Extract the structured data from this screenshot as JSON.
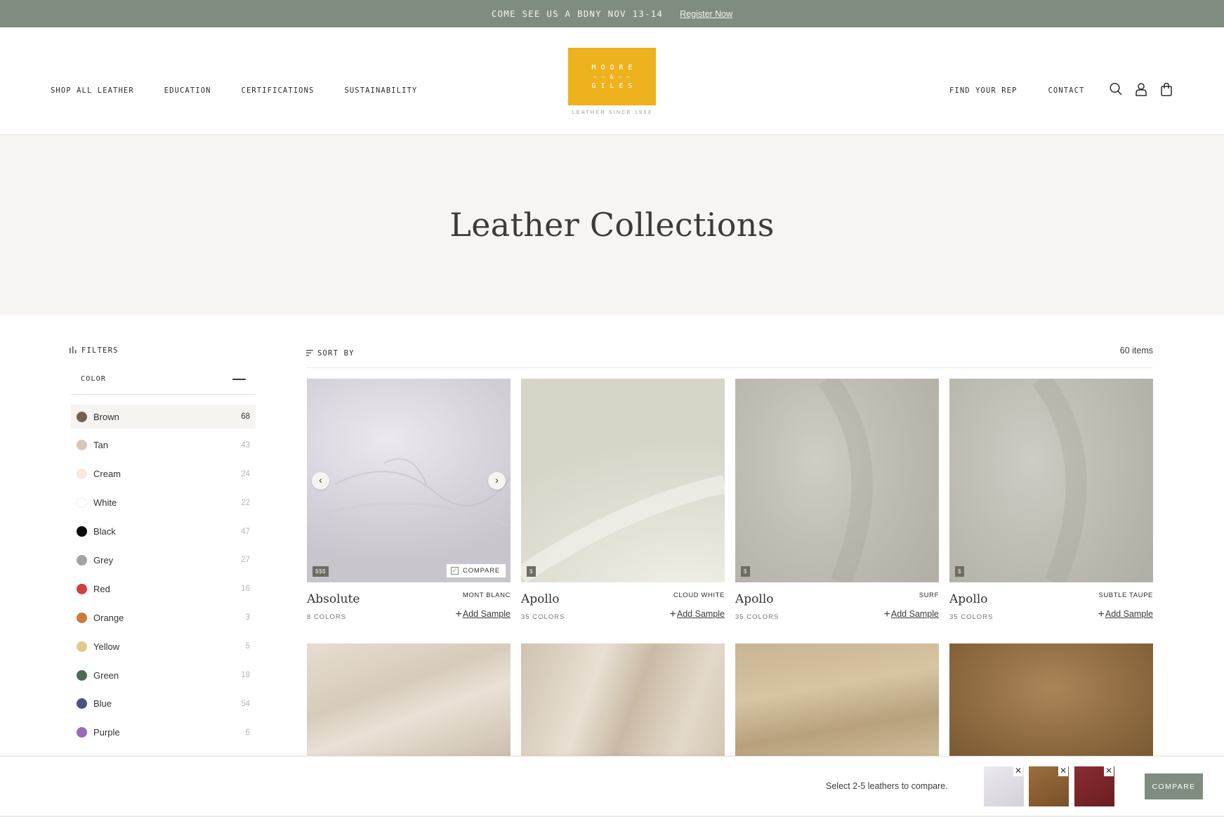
{
  "announcement": {
    "message": "COME SEE US A BDNY NOV 13-14",
    "link": "Register Now"
  },
  "nav": {
    "left": [
      "SHOP ALL LEATHER",
      "EDUCATION",
      "CERTIFICATIONS",
      "SUSTAINABILITY"
    ],
    "right": [
      "FIND YOUR REP",
      "CONTACT"
    ]
  },
  "logo": {
    "line1": "MOORE",
    "line2": "— — & — —",
    "line3": "GILES",
    "tagline": "LEATHER SINCE 1933"
  },
  "icons": [
    "search-icon",
    "account-icon",
    "bag-icon"
  ],
  "hero": {
    "title": "Leather Collections"
  },
  "filters": {
    "label": "FILTERS",
    "color_heading": "COLOR",
    "colors": [
      {
        "name": "Brown",
        "count": "68",
        "swatch": "#76604f",
        "active": true
      },
      {
        "name": "Tan",
        "count": "43",
        "swatch": "#d8c7b7"
      },
      {
        "name": "Cream",
        "count": "24",
        "swatch": "#f7e9dc"
      },
      {
        "name": "White",
        "count": "22",
        "swatch": "#ffffff"
      },
      {
        "name": "Black",
        "count": "47",
        "swatch": "#0c0c0c"
      },
      {
        "name": "Grey",
        "count": "27",
        "swatch": "#a3a3a3"
      },
      {
        "name": "Red",
        "count": "16",
        "swatch": "#d0403d"
      },
      {
        "name": "Orange",
        "count": "3",
        "swatch": "#cd7a3c"
      },
      {
        "name": "Yellow",
        "count": "5",
        "swatch": "#dfc98d"
      },
      {
        "name": "Green",
        "count": "18",
        "swatch": "#4b6b56"
      },
      {
        "name": "Blue",
        "count": "54",
        "swatch": "#4c5280"
      },
      {
        "name": "Purple",
        "count": "6",
        "swatch": "#9a6ab7"
      }
    ]
  },
  "sort": {
    "label": "SORT BY",
    "items_count": "60 items"
  },
  "products": [
    {
      "name": "Absolute",
      "variant": "MONT BLANC",
      "colors": "8 COLORS",
      "price": "$$$",
      "add": "Add Sample",
      "compare": "COMPARE"
    },
    {
      "name": "Apollo",
      "variant": "CLOUD WHITE",
      "colors": "35 COLORS",
      "price": "$",
      "add": "Add Sample"
    },
    {
      "name": "Apollo",
      "variant": "SURF",
      "colors": "35 COLORS",
      "price": "$",
      "add": "Add Sample"
    },
    {
      "name": "Apollo",
      "variant": "SUBTLE TAUPE",
      "colors": "35 COLORS",
      "price": "$",
      "add": "Add Sample"
    }
  ],
  "compare_bar": {
    "hint": "Select 2-5 leathers to compare.",
    "button": "COMPARE"
  }
}
